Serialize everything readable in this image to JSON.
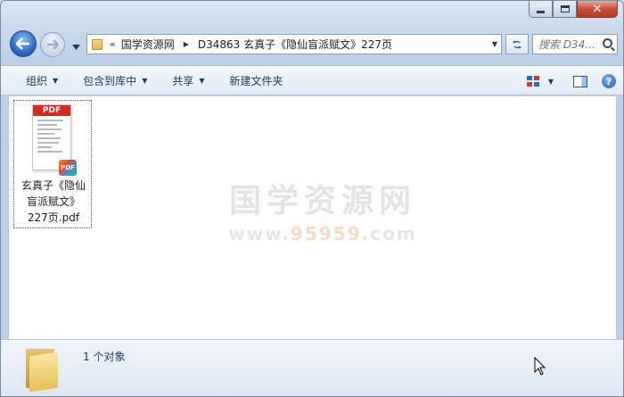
{
  "window": {
    "minimize_glyph": "",
    "close_glyph": "✕"
  },
  "nav": {
    "address_prefix": "«",
    "breadcrumbs": [
      "国学资源网",
      "D34863 玄真子《隐仙盲派赋文》227页"
    ],
    "breadcrumb_separator": "▶",
    "search_placeholder": "搜索 D34..."
  },
  "toolbar": {
    "items": [
      {
        "label": "组织",
        "has_dropdown": true
      },
      {
        "label": "包含到库中",
        "has_dropdown": true
      },
      {
        "label": "共享",
        "has_dropdown": true
      },
      {
        "label": "新建文件夹",
        "has_dropdown": false
      }
    ],
    "help_glyph": "?"
  },
  "content": {
    "file": {
      "icon": "pdf-file-icon",
      "banner": "PDF",
      "badge": "PDF",
      "name_lines": [
        "玄真子《隐仙",
        "盲派赋文》",
        "227页.pdf"
      ]
    },
    "watermark": {
      "title": "国学资源网",
      "site_prefix": "www.",
      "site_highlight": "95959",
      "site_suffix": ".com"
    }
  },
  "details": {
    "icon": "folder-icon",
    "status": "1 个对象"
  },
  "colors": {
    "accent": "#1e395b",
    "pdf_red": "#d62a1e",
    "close_red": "#c7503a"
  }
}
